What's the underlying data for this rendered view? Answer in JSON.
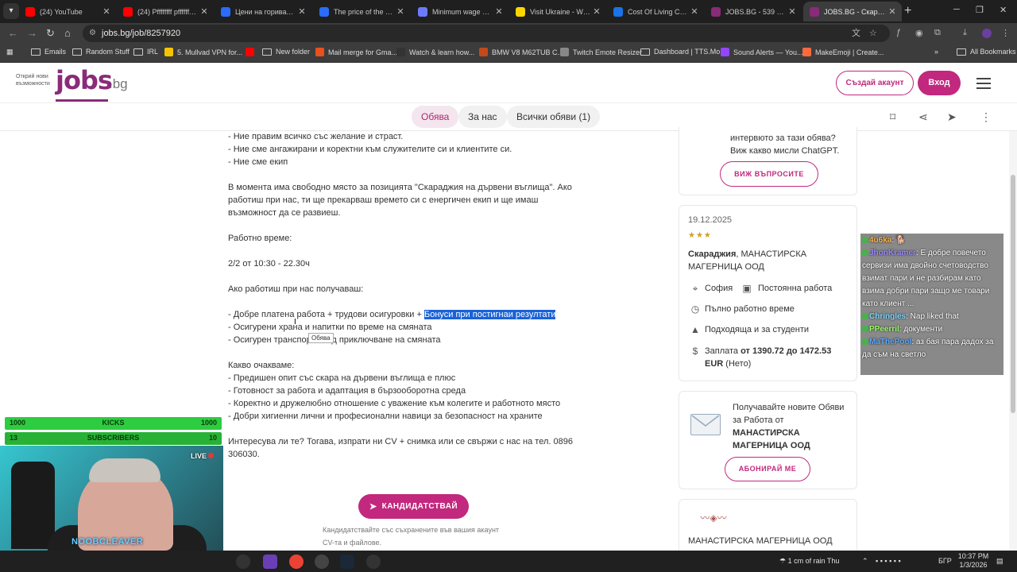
{
  "browser": {
    "tabs": [
      {
        "title": "(24) YouTube",
        "color": "#ff0000"
      },
      {
        "title": "(24) Pffffffff pffffffff pffffffff",
        "color": "#ff0000"
      },
      {
        "title": "Цени на горивата в",
        "color": "#2b6cff"
      },
      {
        "title": "The price of the diesel",
        "color": "#2b6cff"
      },
      {
        "title": "Minimum wage and",
        "color": "#6b7bff"
      },
      {
        "title": "Visit Ukraine - What",
        "color": "#ffd500"
      },
      {
        "title": "Cost Of Living Compa",
        "color": "#1a73e8"
      },
      {
        "title": "JOBS.BG - 539 Обяви",
        "color": "#8a2b79"
      },
      {
        "title": "JOBS.BG - Скараджия",
        "color": "#8a2b79"
      }
    ],
    "url": "jobs.bg/job/8257920",
    "bookmarks": [
      {
        "label": "Emails",
        "type": "folder"
      },
      {
        "label": "Random Stuff",
        "type": "folder"
      },
      {
        "label": "IRL",
        "type": "folder"
      },
      {
        "label": "5. Mullvad VPN for...",
        "type": "site",
        "color": "#f5c400"
      },
      {
        "label": "",
        "type": "site",
        "color": "#ff0000"
      },
      {
        "label": "New folder",
        "type": "folder"
      },
      {
        "label": "Mail merge for Gma...",
        "type": "site",
        "color": "#e8501c"
      },
      {
        "label": "Watch & learn how...",
        "type": "site",
        "color": "#333333"
      },
      {
        "label": "BMW V8 M62TUB C...",
        "type": "site",
        "color": "#c04a1a"
      },
      {
        "label": "Twitch Emote Resizer",
        "type": "site",
        "color": "#888888"
      },
      {
        "label": "Dashboard | TTS.Mo...",
        "type": "folder"
      },
      {
        "label": "Sound Alerts — You...",
        "type": "site",
        "color": "#9146ff"
      },
      {
        "label": "MakeEmoji | Create...",
        "type": "site",
        "color": "#ff6a3d"
      }
    ],
    "all_bookmarks": "All Bookmarks"
  },
  "site": {
    "slogan": "Открий нови възможности",
    "logo": "jobs",
    "logo_suffix": ".bg",
    "create_account": "Създай акаунт",
    "login": "Вход",
    "subnav": {
      "tab_job": "Обява",
      "tab_about": "За нас",
      "tab_all": "Всички обяви (1)"
    }
  },
  "job": {
    "lines": [
      "- Ние правим всичко със желание и страст.",
      "- Ние сме ангажирани и коректни към служителите си и клиентите си.",
      "- Ние сме екип",
      "",
      "В момента има свободно място за позицията \"Скараджия на дървени въглища\". Ако",
      "работиш при нас, ти ще прекарваш времето си с енергичен екип и ще имаш",
      "възможност да се развиеш.",
      "",
      "Работно време:",
      "",
      "2/2 от 10:30 - 22.30ч",
      "",
      "Ако работиш при нас получаваш:",
      ""
    ],
    "benefit1_plain": "- Добре платена работа + трудови осигуровки + ",
    "benefit1_selected": "Бонуси при постигнаи резултати",
    "lines2": [
      "- Осигурени храна и напитки по време на смяната",
      "- Осигурен транспорт след приключване на смяната",
      "",
      "Какво очакваме:",
      "- Предишен опит със скара на дървени въглища е плюс",
      "- Готовност за работа и адаптация в бързооборотна среда",
      "- Коректно и дружелюбно отношение с уважение към колегите и работното място",
      "- Добри хигиенни лични и професионални навици за безопасност на храните",
      "",
      "Интересува ли те? Тогава, изпрати ни CV + снимка или се свържи с нас на тел. 0896",
      "306030."
    ],
    "tooltip": "Обява",
    "apply_button": "КАНДИДАТСТВАЙ",
    "apply_note": "Кандидатствайте със съхранените във вашия акаунт CV-та и файлове."
  },
  "sidebar": {
    "chatgpt_text": "интервюто за тази обява? Виж какво мисли ChatGPT.",
    "chatgpt_button": "ВИЖ ВЪПРОСИТЕ",
    "date": "19.12.2025",
    "rating": 3,
    "position": "Скараджия",
    "company": ", МАНАСТИРСКА МАГЕРНИЦА ООД",
    "location": "София",
    "job_type": "Постоянна работа",
    "schedule": "Пълно работно време",
    "students": "Подходяща и за студенти",
    "salary_prefix": "Заплата ",
    "salary_value": "от 1390.72 до 1472.53 EUR",
    "salary_suffix": " (Нето)",
    "subscribe_text": "Получавайте новите Обяви за Работа от",
    "subscribe_company": "МАНАСТИРСКА МАГЕРНИЦА ООД",
    "subscribe_button": "АБОНИРАЙ МЕ",
    "company_card_name": "МАНАСТИРСКА МАГЕРНИЦА ООД"
  },
  "stream": {
    "chat": [
      {
        "user": "4u6ka",
        "text": ": 🐕",
        "color": "#ffb347"
      },
      {
        "user": "JhonKramer",
        "text": ": Е добре повечето сервизи има двойно счетоводство взимат пари и не разбирам като взима добри пари защо ме товари като клиент ...",
        "color": "#9b8cff"
      },
      {
        "user": "Chringles",
        "text": ": Nap liked that",
        "color": "#7ad7ff"
      },
      {
        "user": "PPeerril",
        "text": ": документи",
        "color": "#9bff6b"
      },
      {
        "user": "MaThePool",
        "text": ": аз бая пара дадох за да съм на светло",
        "color": "#5aa9ff"
      }
    ],
    "goal_kicks": {
      "left": "1000",
      "label": "KICKS",
      "right": "1000"
    },
    "goal_subs": {
      "left": "13",
      "label": "SUBSCRIBERS",
      "right": "10"
    },
    "live": "LIVE",
    "cam_name": "NOOBCLEAVER"
  },
  "taskbar": {
    "weather": "1 cm of rain Thu",
    "lang": "БГР",
    "time": "10:37 PM",
    "date": "1/3/2026"
  }
}
